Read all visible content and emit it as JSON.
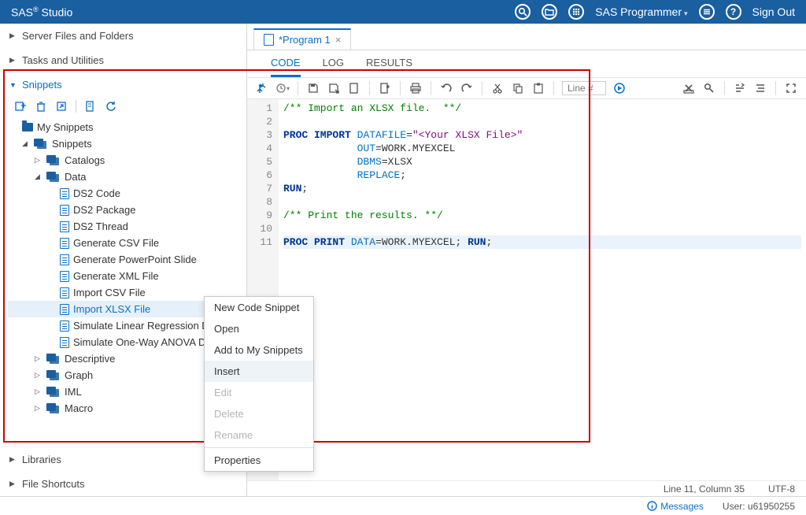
{
  "app": {
    "title_html": "SAS® Studio",
    "role": "SAS Programmer",
    "signout": "Sign Out"
  },
  "sidebar_sections": {
    "files": "Server Files and Folders",
    "tasks": "Tasks and Utilities",
    "snippets": "Snippets",
    "libraries": "Libraries",
    "shortcuts": "File Shortcuts"
  },
  "snippets": {
    "my": "My Snippets",
    "root": "Snippets",
    "catalogs": "Catalogs",
    "data": "Data",
    "data_items": [
      "DS2 Code",
      "DS2 Package",
      "DS2 Thread",
      "Generate CSV File",
      "Generate PowerPoint Slide",
      "Generate XML File",
      "Import CSV File",
      "Import XLSX File",
      "Simulate Linear Regression Data",
      "Simulate One-Way ANOVA Data"
    ],
    "descriptive": "Descriptive",
    "graph": "Graph",
    "iml": "IML",
    "macro": "Macro"
  },
  "context_menu": [
    {
      "label": "New Code Snippet",
      "enabled": true
    },
    {
      "label": "Open",
      "enabled": true
    },
    {
      "label": "Add to My Snippets",
      "enabled": true
    },
    {
      "label": "Insert",
      "enabled": true,
      "highlight": true
    },
    {
      "label": "Edit",
      "enabled": false
    },
    {
      "label": "Delete",
      "enabled": false
    },
    {
      "label": "Rename",
      "enabled": false
    },
    {
      "label": "Properties",
      "enabled": true
    }
  ],
  "editor": {
    "tab": "*Program 1",
    "subtabs": {
      "code": "CODE",
      "log": "LOG",
      "results": "RESULTS"
    },
    "line_placeholder": "Line #"
  },
  "code_lines": [
    {
      "n": 1,
      "seg": [
        {
          "t": "/** Import an XLSX file.  **/",
          "c": "cm"
        }
      ]
    },
    {
      "n": 2,
      "seg": []
    },
    {
      "n": 3,
      "seg": [
        {
          "t": "PROC IMPORT",
          "c": "kw"
        },
        {
          "t": " ",
          "c": "plain"
        },
        {
          "t": "DATAFILE",
          "c": "opt"
        },
        {
          "t": "=",
          "c": "plain"
        },
        {
          "t": "\"<Your XLSX File>\"",
          "c": "str"
        }
      ]
    },
    {
      "n": 4,
      "seg": [
        {
          "t": "            ",
          "c": "plain"
        },
        {
          "t": "OUT",
          "c": "opt"
        },
        {
          "t": "=WORK.MYEXCEL",
          "c": "plain"
        }
      ]
    },
    {
      "n": 5,
      "seg": [
        {
          "t": "            ",
          "c": "plain"
        },
        {
          "t": "DBMS",
          "c": "opt"
        },
        {
          "t": "=XLSX",
          "c": "plain"
        }
      ]
    },
    {
      "n": 6,
      "seg": [
        {
          "t": "            ",
          "c": "plain"
        },
        {
          "t": "REPLACE",
          "c": "opt"
        },
        {
          "t": ";",
          "c": "plain"
        }
      ]
    },
    {
      "n": 7,
      "seg": [
        {
          "t": "RUN",
          "c": "kw"
        },
        {
          "t": ";",
          "c": "plain"
        }
      ]
    },
    {
      "n": 8,
      "seg": []
    },
    {
      "n": 9,
      "seg": [
        {
          "t": "/** Print the results. **/",
          "c": "cm"
        }
      ]
    },
    {
      "n": 10,
      "seg": []
    },
    {
      "n": 11,
      "hl": true,
      "seg": [
        {
          "t": "PROC PRINT",
          "c": "kw"
        },
        {
          "t": " ",
          "c": "plain"
        },
        {
          "t": "DATA",
          "c": "opt"
        },
        {
          "t": "=WORK.MYEXCEL; ",
          "c": "plain"
        },
        {
          "t": "RUN",
          "c": "kw"
        },
        {
          "t": ";",
          "c": "plain"
        }
      ]
    }
  ],
  "status": {
    "pos": "Line 11, Column 35",
    "enc": "UTF-8",
    "messages": "Messages",
    "user": "User: u61950255"
  }
}
